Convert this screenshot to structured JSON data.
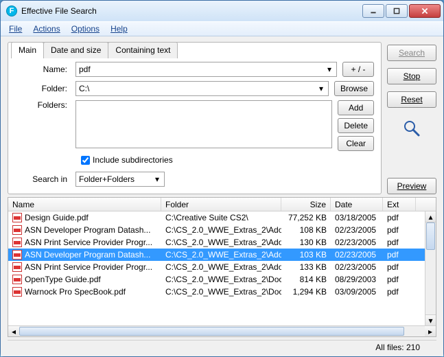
{
  "window": {
    "title": "Effective File Search"
  },
  "menu": {
    "file": "File",
    "actions": "Actions",
    "options": "Options",
    "help": "Help"
  },
  "tabs": {
    "main": "Main",
    "date_size": "Date and size",
    "containing": "Containing text"
  },
  "form": {
    "name_label": "Name:",
    "name_value": "pdf",
    "plusminus": "+ / -",
    "folder_label": "Folder:",
    "folder_value": "C:\\",
    "browse": "Browse",
    "folders_label": "Folders:",
    "add": "Add",
    "delete": "Delete",
    "clear": "Clear",
    "include_sub": "Include subdirectories",
    "searchin_label": "Search in",
    "searchin_value": "Folder+Folders"
  },
  "side": {
    "search": "Search",
    "stop": "Stop",
    "reset": "Reset",
    "preview": "Preview"
  },
  "results": {
    "headers": {
      "name": "Name",
      "folder": "Folder",
      "size": "Size",
      "date": "Date",
      "ext": "Ext"
    },
    "rows": [
      {
        "name": "Design Guide.pdf",
        "folder": "C:\\Creative Suite CS2\\",
        "size": "77,252 KB",
        "date": "03/18/2005",
        "ext": "pdf",
        "selected": false
      },
      {
        "name": "ASN Developer Program Datash...",
        "folder": "C:\\CS_2.0_WWE_Extras_2\\Ado...",
        "size": "108 KB",
        "date": "02/23/2005",
        "ext": "pdf",
        "selected": false
      },
      {
        "name": "ASN Print Service Provider Progr...",
        "folder": "C:\\CS_2.0_WWE_Extras_2\\Ado...",
        "size": "130 KB",
        "date": "02/23/2005",
        "ext": "pdf",
        "selected": false
      },
      {
        "name": "ASN Developer Program Datash...",
        "folder": "C:\\CS_2.0_WWE_Extras_2\\Ado...",
        "size": "103 KB",
        "date": "02/23/2005",
        "ext": "pdf",
        "selected": true
      },
      {
        "name": "ASN Print Service Provider Progr...",
        "folder": "C:\\CS_2.0_WWE_Extras_2\\Ado...",
        "size": "133 KB",
        "date": "02/23/2005",
        "ext": "pdf",
        "selected": false
      },
      {
        "name": "OpenType Guide.pdf",
        "folder": "C:\\CS_2.0_WWE_Extras_2\\Doc...",
        "size": "814 KB",
        "date": "08/29/2003",
        "ext": "pdf",
        "selected": false
      },
      {
        "name": "Warnock Pro SpecBook.pdf",
        "folder": "C:\\CS_2.0_WWE_Extras_2\\Doc...",
        "size": "1,294 KB",
        "date": "03/09/2005",
        "ext": "pdf",
        "selected": false
      }
    ]
  },
  "status": {
    "all_files": "All files: 210"
  }
}
